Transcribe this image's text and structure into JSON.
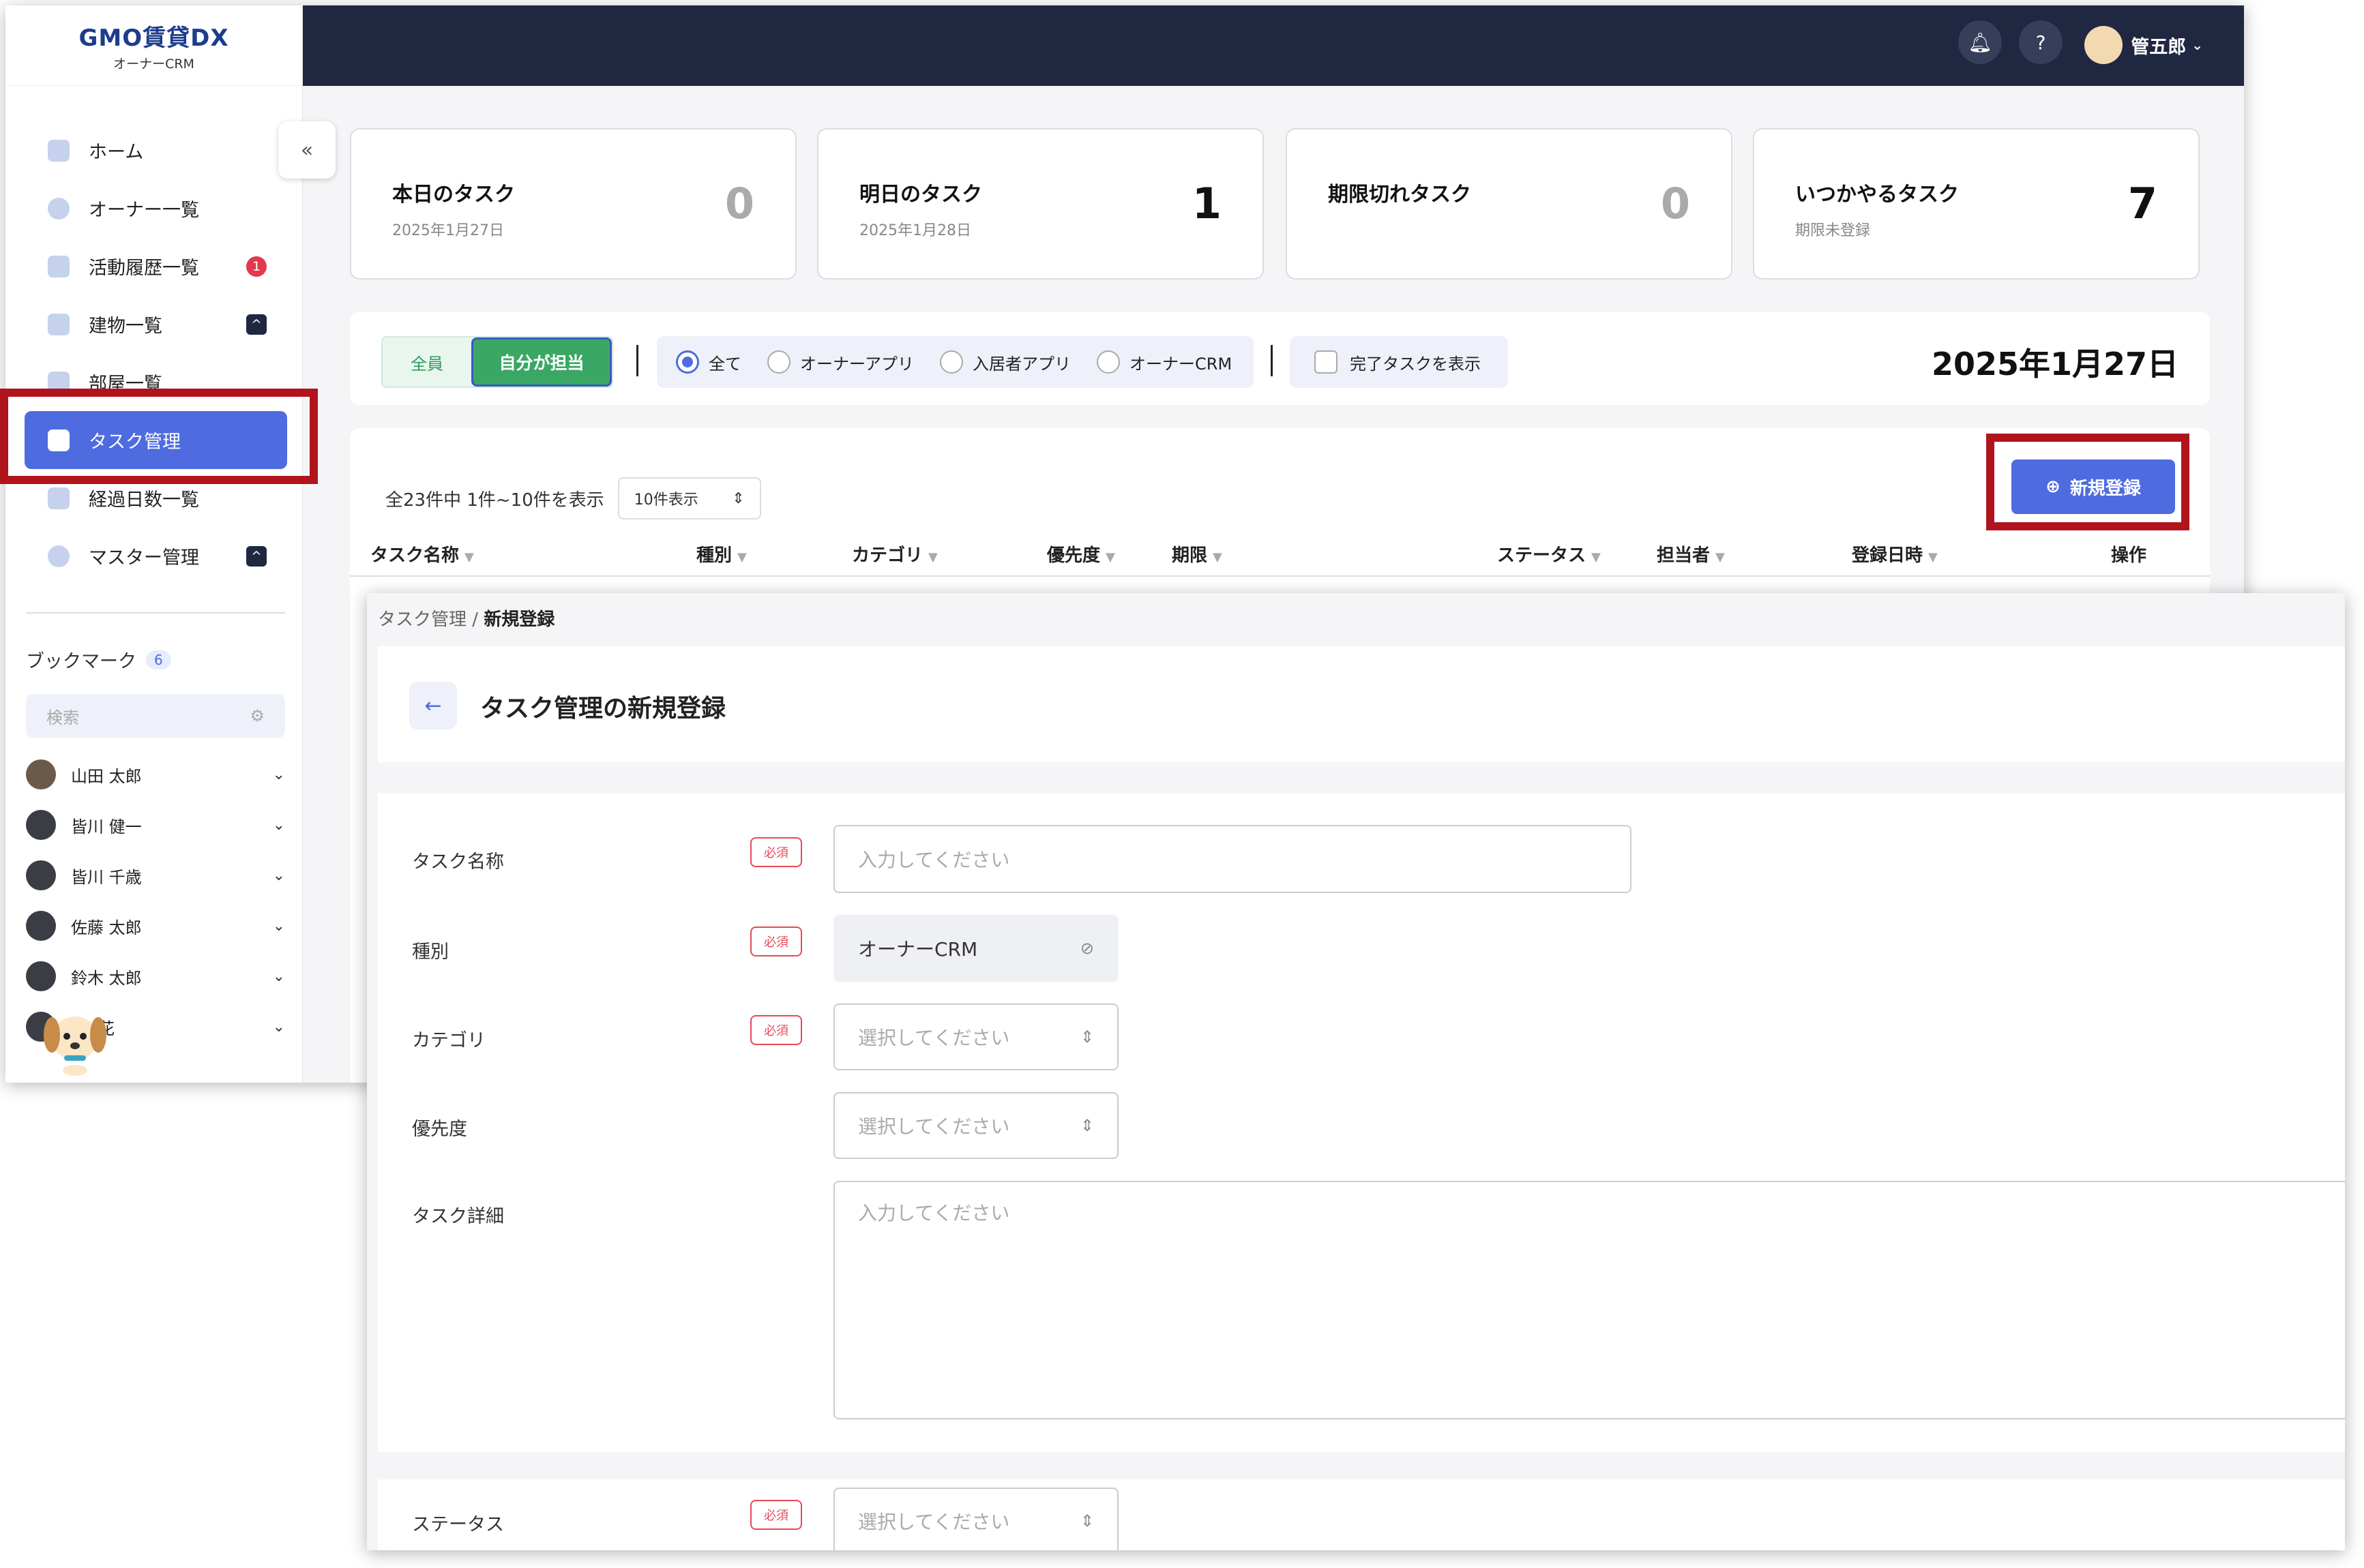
{
  "logo": {
    "brand": "GMO賃貸DX",
    "product": "オーナーCRM"
  },
  "sidebar": {
    "collapse_icon": "«",
    "items": [
      {
        "label": "ホーム"
      },
      {
        "label": "オーナー一覧"
      },
      {
        "label": "活動履歴一覧",
        "badge": "1"
      },
      {
        "label": "建物一覧",
        "badge": "^"
      },
      {
        "label": "部屋一覧"
      },
      {
        "label": "タスク管理"
      },
      {
        "label": "経過日数一覧"
      },
      {
        "label": "マスター管理",
        "badge": "^"
      }
    ],
    "bookmarks": {
      "title": "ブックマーク",
      "count": "6",
      "search_placeholder": "検索",
      "people": [
        "山田 太郎",
        "皆川 健一",
        "皆川 千歳",
        "佐藤 太郎",
        "鈴木 太郎",
        "花"
      ]
    }
  },
  "topbar": {
    "user": "管五郎"
  },
  "cards": [
    {
      "title": "本日のタスク",
      "sub": "2025年1月27日",
      "value": "0"
    },
    {
      "title": "明日のタスク",
      "sub": "2025年1月28日",
      "value": "1"
    },
    {
      "title": "期限切れタスク",
      "sub": "",
      "value": "0"
    },
    {
      "title": "いつかやるタスク",
      "sub": "期限未登録",
      "value": "7"
    }
  ],
  "filter": {
    "seg_all": "全員",
    "seg_mine": "自分が担当",
    "radios": [
      "全て",
      "オーナーアプリ",
      "入居者アプリ",
      "オーナーCRM"
    ],
    "done_label": "完了タスクを表示",
    "date": "2025年1月27日"
  },
  "list": {
    "count": "全23件中 1件~10件を表示",
    "per_page": "10件表示",
    "new_button": "新規登録",
    "columns": [
      "タスク名称",
      "種別",
      "カテゴリ",
      "優先度",
      "期限",
      "ステータス",
      "担当者",
      "登録日時",
      "操作"
    ]
  },
  "modal": {
    "crumb_parent": "タスク管理",
    "crumb_sep": " / ",
    "crumb_current": "新規登録",
    "title": "タスク管理の新規登録",
    "required": "必須",
    "fields": {
      "name": {
        "label": "タスク名称",
        "placeholder": "入力してください"
      },
      "type": {
        "label": "種別",
        "value": "オーナーCRM"
      },
      "category": {
        "label": "カテゴリ",
        "placeholder": "選択してください"
      },
      "priority": {
        "label": "優先度",
        "placeholder": "選択してください"
      },
      "detail": {
        "label": "タスク詳細",
        "placeholder": "入力してください"
      },
      "status": {
        "label": "ステータス",
        "placeholder": "選択してください"
      }
    }
  },
  "colors": {
    "accent": "#4e6ce0",
    "navy": "#1f2741",
    "green": "#3aa864",
    "highlight": "#b0141d",
    "danger": "#e34b57"
  }
}
